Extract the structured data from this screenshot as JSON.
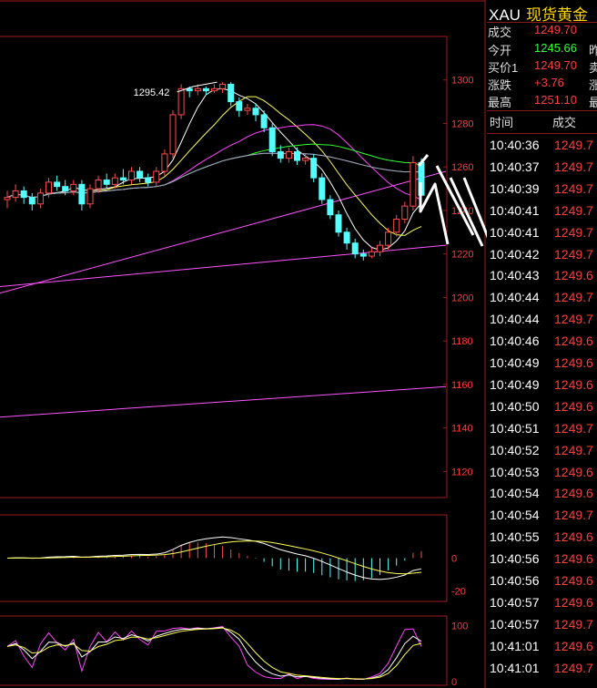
{
  "symbol": {
    "code": "XAU",
    "name": "现货黄金"
  },
  "quote": [
    {
      "label": "成交",
      "value": "1249.70",
      "color": "#ff3b3b",
      "side": ""
    },
    {
      "label": "今开",
      "value": "1245.66",
      "color": "#33ff33",
      "side": "昨"
    },
    {
      "label": "买价1",
      "value": "1249.70",
      "color": "#ff3b3b",
      "side": "卖"
    },
    {
      "label": "涨跌",
      "value": "+3.76",
      "color": "#ff3b3b",
      "side": "涨"
    },
    {
      "label": "最高",
      "value": "1251.10",
      "color": "#ff3b3b",
      "side": "最"
    }
  ],
  "ticks_header": {
    "time": "时间",
    "price": "成交"
  },
  "ticks": [
    {
      "t": "10:40:36",
      "p": "1249.7"
    },
    {
      "t": "10:40:37",
      "p": "1249.7"
    },
    {
      "t": "10:40:39",
      "p": "1249.7"
    },
    {
      "t": "10:40:41",
      "p": "1249.7"
    },
    {
      "t": "10:40:41",
      "p": "1249.7"
    },
    {
      "t": "10:40:42",
      "p": "1249.7"
    },
    {
      "t": "10:40:43",
      "p": "1249.6"
    },
    {
      "t": "10:40:44",
      "p": "1249.7"
    },
    {
      "t": "10:40:44",
      "p": "1249.7"
    },
    {
      "t": "10:40:46",
      "p": "1249.6"
    },
    {
      "t": "10:40:49",
      "p": "1249.6"
    },
    {
      "t": "10:40:49",
      "p": "1249.6"
    },
    {
      "t": "10:40:50",
      "p": "1249.6"
    },
    {
      "t": "10:40:51",
      "p": "1249.7"
    },
    {
      "t": "10:40:52",
      "p": "1249.7"
    },
    {
      "t": "10:40:53",
      "p": "1249.6"
    },
    {
      "t": "10:40:54",
      "p": "1249.6"
    },
    {
      "t": "10:40:54",
      "p": "1249.7"
    },
    {
      "t": "10:40:55",
      "p": "1249.6"
    },
    {
      "t": "10:40:56",
      "p": "1249.6"
    },
    {
      "t": "10:40:56",
      "p": "1249.6"
    },
    {
      "t": "10:40:57",
      "p": "1249.6"
    },
    {
      "t": "10:40:57",
      "p": "1249.7"
    },
    {
      "t": "10:41:01",
      "p": "1249.6"
    },
    {
      "t": "10:41:01",
      "p": "1249.7"
    }
  ],
  "chart_data": {
    "type": "candlestick",
    "price_axis": {
      "ticks": [
        1300,
        1280,
        1260,
        1240,
        1220,
        1200,
        1180,
        1160,
        1140,
        1120
      ],
      "range": [
        1108,
        1320
      ]
    },
    "high_annotation": "1295.42",
    "candles": [
      [
        1245,
        1246,
        1241,
        1249
      ],
      [
        1246,
        1249,
        1244,
        1252
      ],
      [
        1249,
        1246,
        1243,
        1251
      ],
      [
        1246,
        1243,
        1240,
        1248
      ],
      [
        1243,
        1248,
        1241,
        1250
      ],
      [
        1248,
        1253,
        1246,
        1255
      ],
      [
        1253,
        1251,
        1249,
        1256
      ],
      [
        1251,
        1249,
        1247,
        1254
      ],
      [
        1249,
        1252,
        1247,
        1254
      ],
      [
        1252,
        1243,
        1240,
        1254
      ],
      [
        1243,
        1250,
        1241,
        1252
      ],
      [
        1250,
        1254,
        1248,
        1256
      ],
      [
        1254,
        1252,
        1250,
        1257
      ],
      [
        1252,
        1255,
        1250,
        1257
      ],
      [
        1255,
        1254,
        1252,
        1259
      ],
      [
        1254,
        1258,
        1252,
        1260
      ],
      [
        1258,
        1255,
        1253,
        1260
      ],
      [
        1255,
        1253,
        1251,
        1257
      ],
      [
        1253,
        1258,
        1251,
        1260
      ],
      [
        1258,
        1266,
        1256,
        1268
      ],
      [
        1266,
        1284,
        1264,
        1286
      ],
      [
        1284,
        1296,
        1282,
        1298
      ],
      [
        1296,
        1295,
        1292,
        1297
      ],
      [
        1295,
        1296,
        1293,
        1298
      ],
      [
        1296,
        1295,
        1293,
        1297
      ],
      [
        1295,
        1296,
        1294,
        1298
      ],
      [
        1296,
        1298,
        1294,
        1299
      ],
      [
        1298,
        1290,
        1288,
        1299
      ],
      [
        1290,
        1286,
        1283,
        1292
      ],
      [
        1286,
        1287,
        1284,
        1289
      ],
      [
        1287,
        1284,
        1281,
        1289
      ],
      [
        1284,
        1278,
        1276,
        1286
      ],
      [
        1278,
        1267,
        1265,
        1280
      ],
      [
        1267,
        1264,
        1262,
        1270
      ],
      [
        1264,
        1267,
        1262,
        1269
      ],
      [
        1267,
        1263,
        1261,
        1269
      ],
      [
        1263,
        1264,
        1261,
        1266
      ],
      [
        1264,
        1255,
        1253,
        1266
      ],
      [
        1255,
        1245,
        1243,
        1257
      ],
      [
        1245,
        1238,
        1236,
        1247
      ],
      [
        1238,
        1230,
        1228,
        1240
      ],
      [
        1230,
        1225,
        1222,
        1232
      ],
      [
        1225,
        1220,
        1218,
        1227
      ],
      [
        1220,
        1219,
        1217,
        1222
      ],
      [
        1219,
        1221,
        1218,
        1223
      ],
      [
        1221,
        1224,
        1219,
        1226
      ],
      [
        1224,
        1230,
        1222,
        1232
      ],
      [
        1230,
        1236,
        1228,
        1238
      ],
      [
        1236,
        1242,
        1234,
        1244
      ],
      [
        1242,
        1262,
        1240,
        1265
      ],
      [
        1262,
        1247,
        1245,
        1264
      ]
    ],
    "macd_axis": {
      "ticks": [
        0,
        -20
      ],
      "range": [
        -26,
        26
      ]
    },
    "rsi_axis": {
      "ticks": [
        100,
        0
      ],
      "range": [
        -5,
        115
      ]
    }
  }
}
